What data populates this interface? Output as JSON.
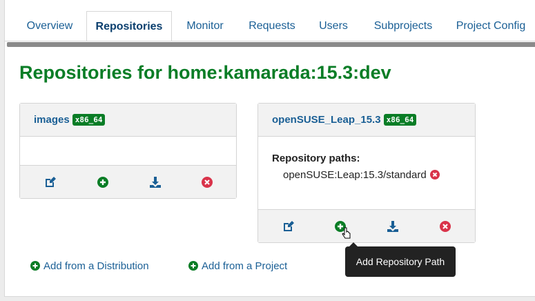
{
  "tabs": [
    {
      "label": "Overview",
      "active": false
    },
    {
      "label": "Repositories",
      "active": true
    },
    {
      "label": "Monitor",
      "active": false
    },
    {
      "label": "Requests",
      "active": false
    },
    {
      "label": "Users",
      "active": false
    },
    {
      "label": "Subprojects",
      "active": false
    },
    {
      "label": "Project Config",
      "active": false
    }
  ],
  "page_title": "Repositories for home:kamarada:15.3:dev",
  "repositories": [
    {
      "name": "images",
      "arch": "x86_64",
      "paths_label": "",
      "paths": []
    },
    {
      "name": "openSUSE_Leap_15.3",
      "arch": "x86_64",
      "paths_label": "Repository paths:",
      "paths": [
        "openSUSE:Leap:15.3/standard"
      ]
    }
  ],
  "actions": {
    "edit_icon": "edit-icon",
    "add_icon": "plus-circle-icon",
    "download_icon": "download-icon",
    "delete_icon": "delete-circle-icon"
  },
  "add_links": {
    "distribution": "Add from a Distribution",
    "project": "Add from a Project"
  },
  "tooltip": "Add Repository Path",
  "colors": {
    "link": "#1a5f95",
    "green": "#0a7d26",
    "red": "#d9334a",
    "badge_bg": "#0a7d26"
  }
}
